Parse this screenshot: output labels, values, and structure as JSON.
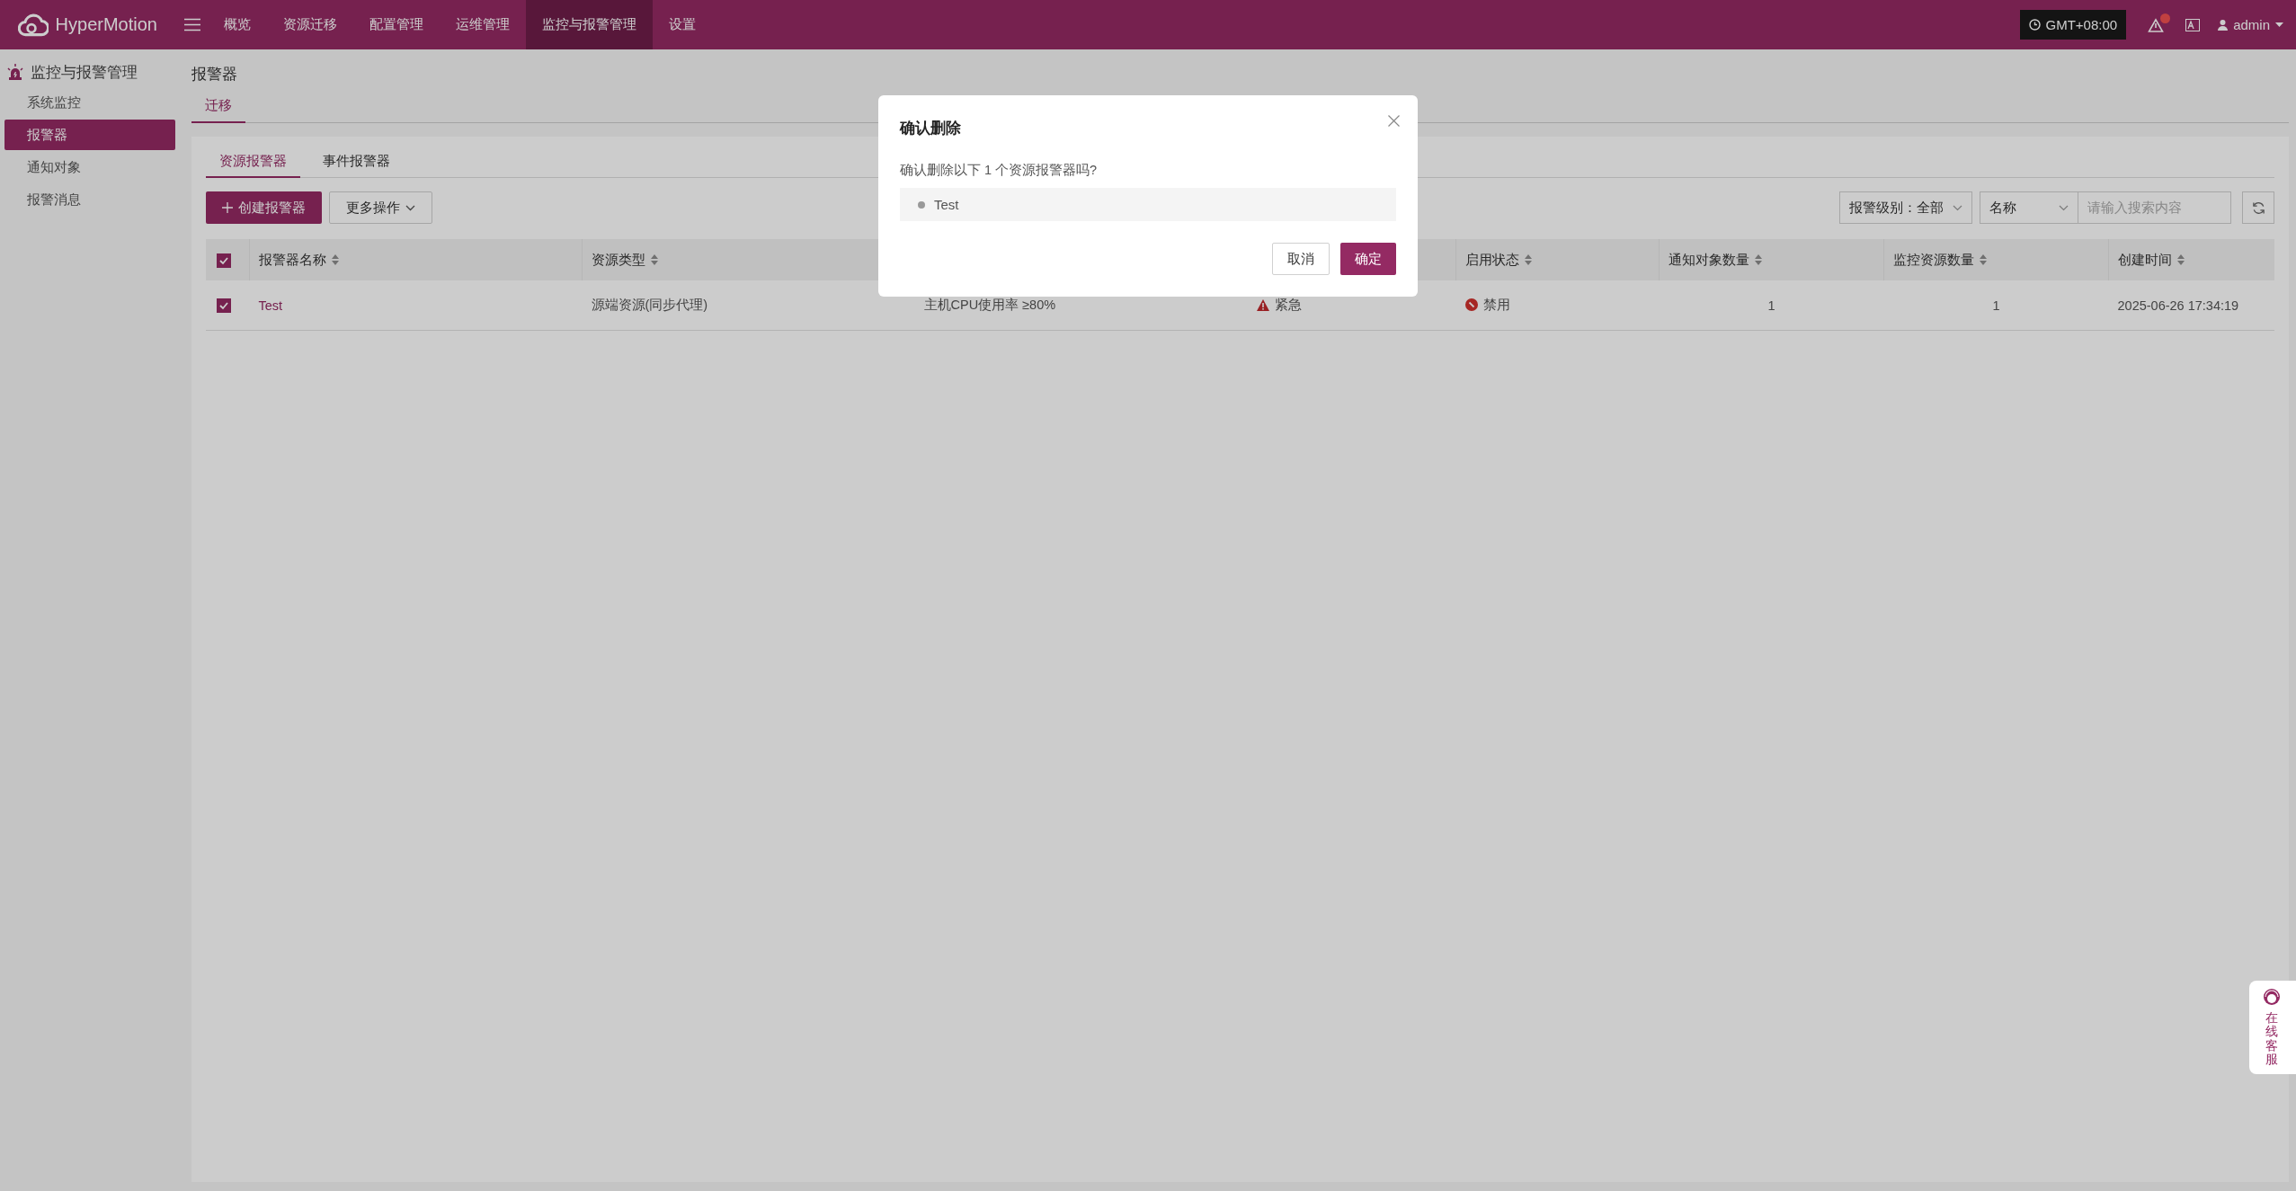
{
  "topbar": {
    "brand": "HyperMotion",
    "nav": [
      {
        "label": "概览",
        "selected": false
      },
      {
        "label": "资源迁移",
        "selected": false
      },
      {
        "label": "配置管理",
        "selected": false
      },
      {
        "label": "运维管理",
        "selected": false
      },
      {
        "label": "监控与报警管理",
        "selected": true
      },
      {
        "label": "设置",
        "selected": false
      }
    ],
    "timezone": "GMT+08:00",
    "user": "admin"
  },
  "sidebar": {
    "title": "监控与报警管理",
    "items": [
      {
        "label": "系统监控",
        "selected": false
      },
      {
        "label": "报警器",
        "selected": true
      },
      {
        "label": "通知对象",
        "selected": false
      },
      {
        "label": "报警消息",
        "selected": false
      }
    ]
  },
  "page": {
    "title": "报警器",
    "tabs": [
      {
        "label": "迁移",
        "selected": true
      }
    ]
  },
  "subtabs": [
    {
      "label": "资源报警器",
      "selected": true
    },
    {
      "label": "事件报警器",
      "selected": false
    }
  ],
  "toolbar": {
    "create_button": "创建报警器",
    "more_button": "更多操作",
    "level_filter": {
      "label": "报警级别：",
      "value": "全部"
    },
    "search": {
      "field": "名称",
      "placeholder": "请输入搜索内容"
    }
  },
  "table": {
    "all_checked": true,
    "columns": [
      "报警器名称",
      "资源类型",
      null,
      null,
      "启用状态",
      "通知对象数量",
      "监控资源数量",
      "创建时间"
    ],
    "rows": [
      {
        "checked": true,
        "name": "Test",
        "resource_type": "源端资源(同步代理)",
        "column_3": "主机CPU使用率 ≥80%",
        "column_4": "紧急",
        "status": "禁用",
        "enabled": false,
        "notify_count": "1",
        "resource_count": "1",
        "created": "2025-06-26 17:34:19"
      }
    ]
  },
  "dialog": {
    "title": "确认删除",
    "message": "确认删除以下 1 个资源报警器吗?",
    "items": [
      "Test"
    ],
    "cancel": "取消",
    "confirm": "确定"
  },
  "support": {
    "label": "在线客服"
  }
}
